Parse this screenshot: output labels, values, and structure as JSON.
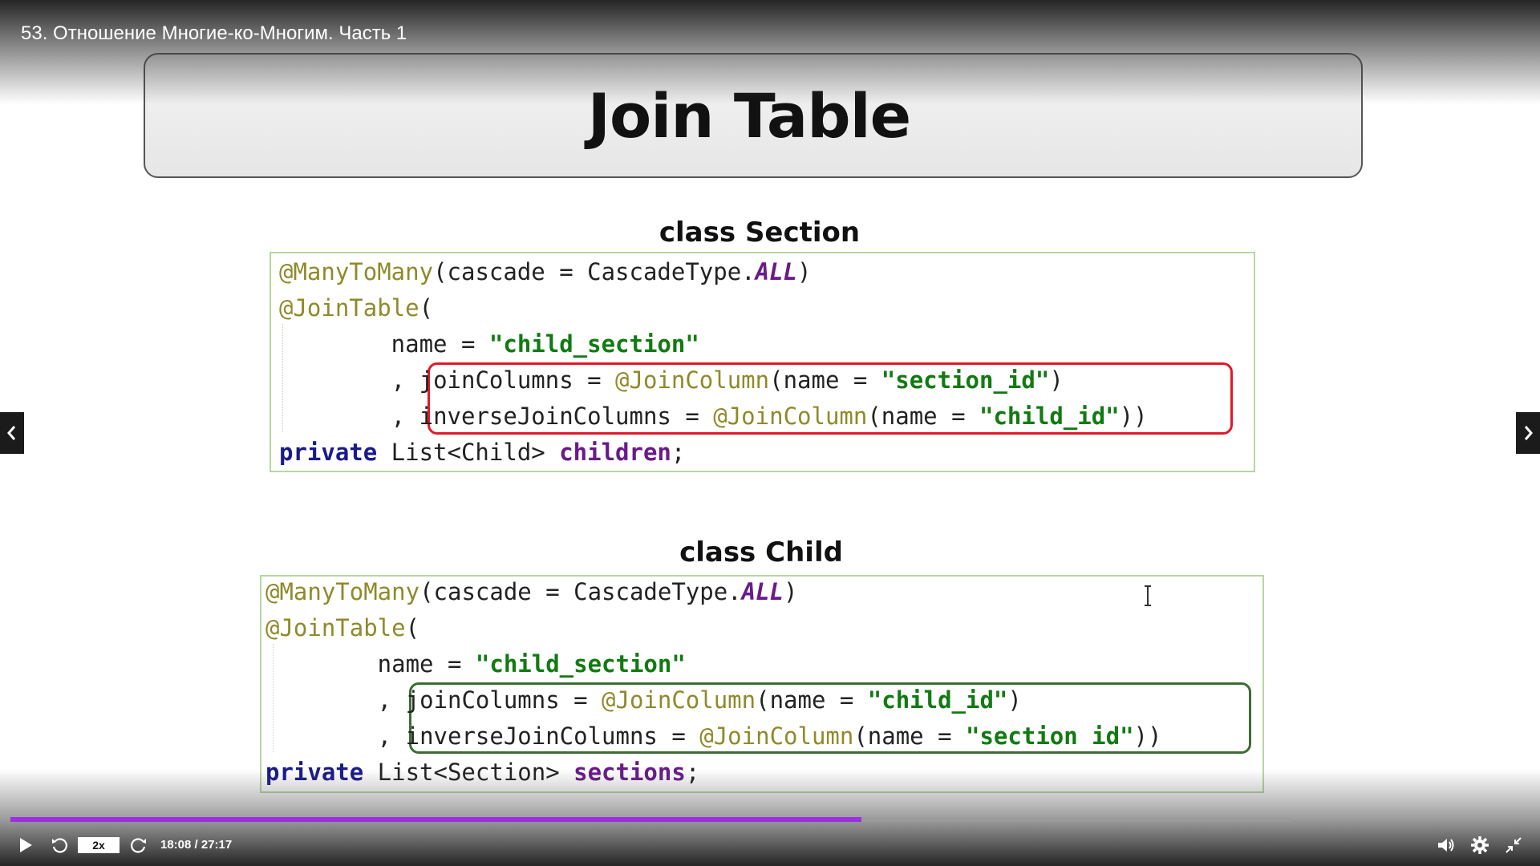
{
  "player": {
    "video_title": "53. Отношение Многие-ко-Многим. Часть 1",
    "speed_label": "2x",
    "time_display": "18:08 / 27:17",
    "progress": 0.665,
    "accent_color": "#9b30e0"
  },
  "slide": {
    "title": "Join Table",
    "section_heading": "class Section",
    "child_heading": "class Child",
    "section_code": {
      "l1_ann": "@ManyToMany",
      "l1_a": "(cascade = CascadeType.",
      "l1_const": "ALL",
      "l1_b": ")",
      "l2_ann": "@JoinTable",
      "l2_b": "(",
      "l3_a": "        name = ",
      "l3_str": "\"child_section\"",
      "l4_comma": "        , ",
      "l4_a": "joinColumns = ",
      "l4_ann": "@JoinColumn",
      "l4_b": "(name = ",
      "l4_str": "\"section_id\"",
      "l4_c": ")",
      "l5_comma": "        , ",
      "l5_a": "inverseJoinColumns = ",
      "l5_ann": "@JoinColumn",
      "l5_b": "(name = ",
      "l5_str": "\"child_id\"",
      "l5_c": "))",
      "l6_kw": "private",
      "l6_a": " List<Child> ",
      "l6_fld": "children",
      "l6_b": ";"
    },
    "child_code": {
      "l1_ann": "@ManyToMany",
      "l1_a": "(cascade = CascadeType.",
      "l1_const": "ALL",
      "l1_b": ")",
      "l2_ann": "@JoinTable",
      "l2_b": "(",
      "l3_a": "        name = ",
      "l3_str": "\"child_section\"",
      "l4_comma": "        , ",
      "l4_a": "joinColumns = ",
      "l4_ann": "@JoinColumn",
      "l4_b": "(name = ",
      "l4_str": "\"child_id\"",
      "l4_c": ")",
      "l5_comma": "        , ",
      "l5_a": "inverseJoinColumns = ",
      "l5_ann": "@JoinColumn",
      "l5_b": "(name = ",
      "l5_str": "\"section id\"",
      "l5_c": "))",
      "l6_kw": "private",
      "l6_a": " List<Section> ",
      "l6_fld": "sections",
      "l6_b": ";"
    },
    "highlight_colors": {
      "section": "#e0192a",
      "child": "#3d6b34"
    }
  },
  "icons": {
    "prev": "chevron-left-icon",
    "next": "chevron-right-icon",
    "play": "play-icon",
    "rewind": "rewind-icon",
    "forward": "forward-icon",
    "volume": "volume-icon",
    "settings": "gear-icon",
    "exit_fullscreen": "exit-fullscreen-icon"
  }
}
